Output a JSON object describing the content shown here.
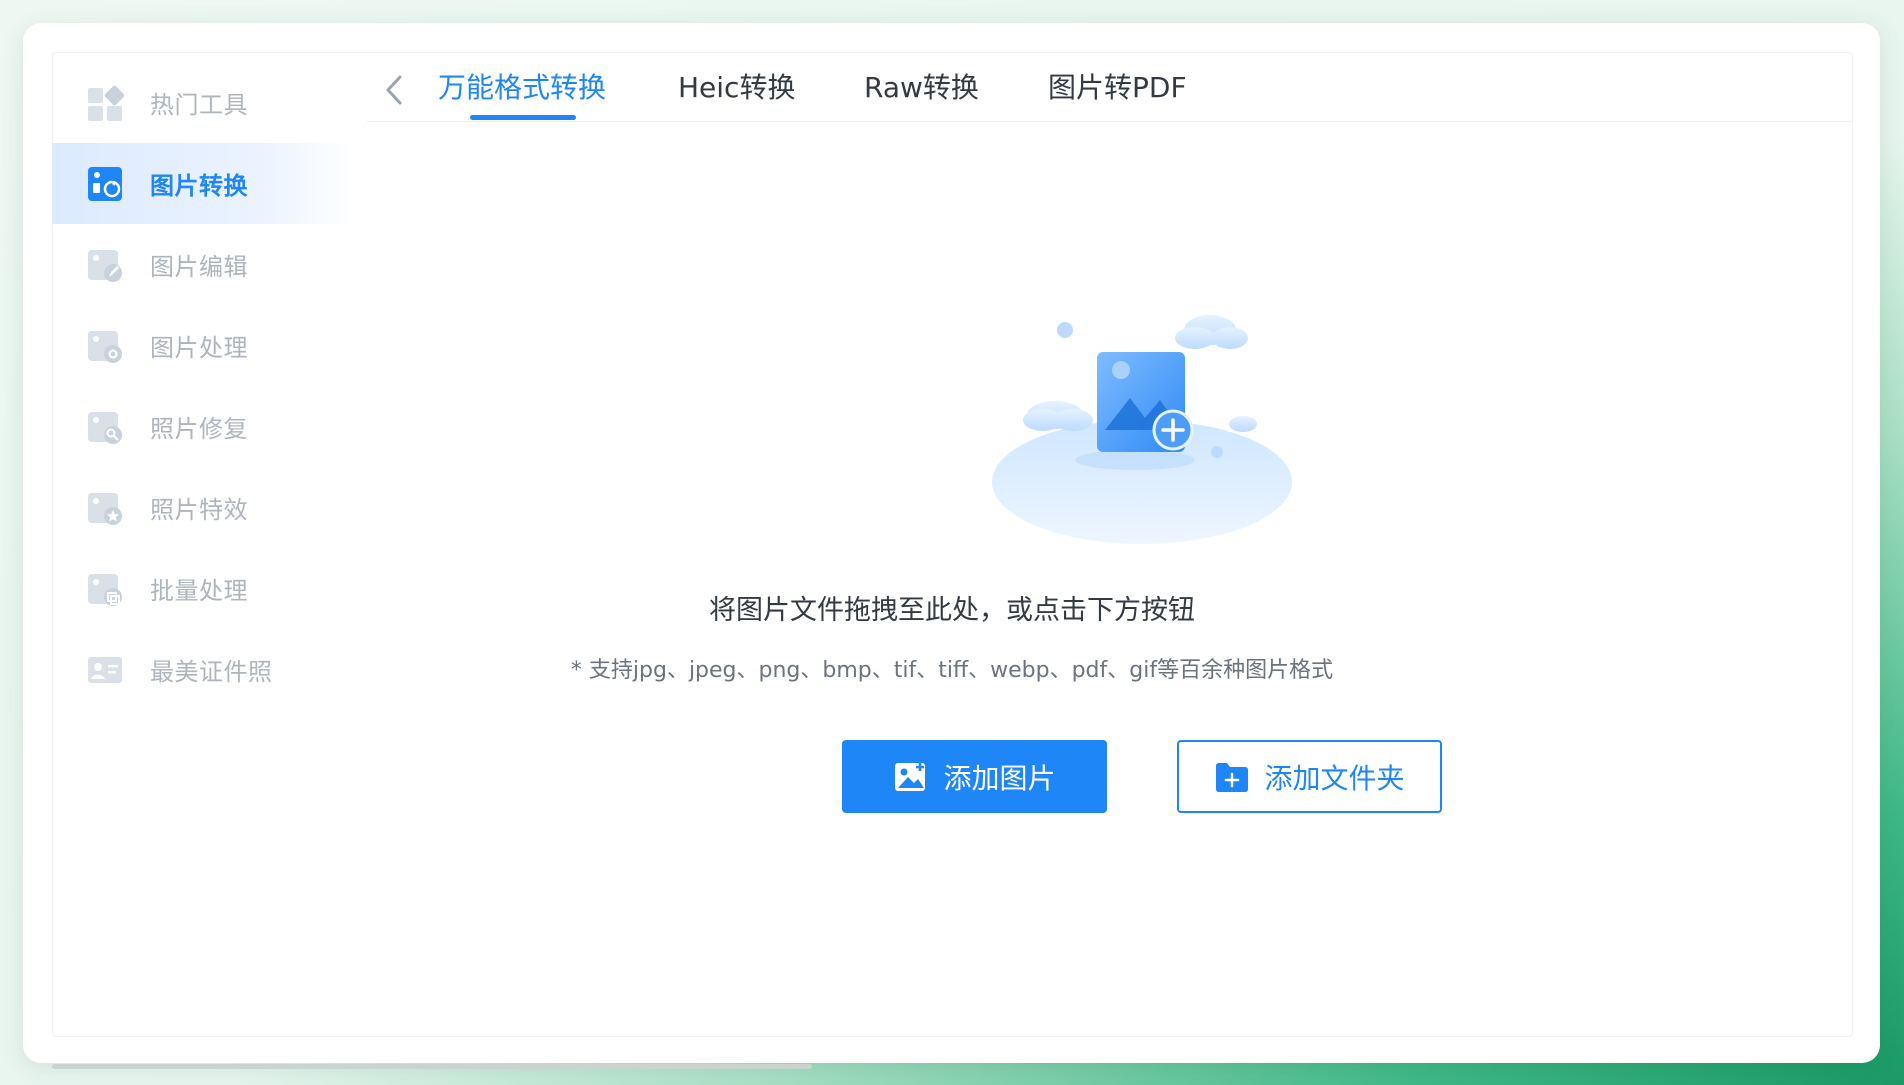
{
  "sidebar": {
    "items": [
      {
        "label": "热门工具",
        "icon": "hot-tools-icon"
      },
      {
        "label": "图片转换",
        "icon": "image-convert-icon",
        "active": true
      },
      {
        "label": "图片编辑",
        "icon": "image-edit-icon"
      },
      {
        "label": "图片处理",
        "icon": "image-process-icon"
      },
      {
        "label": "照片修复",
        "icon": "photo-repair-icon"
      },
      {
        "label": "照片特效",
        "icon": "photo-effects-icon"
      },
      {
        "label": "批量处理",
        "icon": "batch-process-icon"
      },
      {
        "label": "最美证件照",
        "icon": "id-photo-icon"
      }
    ]
  },
  "tabs": [
    {
      "label": "万能格式转换",
      "active": true
    },
    {
      "label": "Heic转换"
    },
    {
      "label": "Raw转换"
    },
    {
      "label": "图片转PDF"
    }
  ],
  "dropzone": {
    "title": "将图片文件拖拽至此处，或点击下方按钮",
    "hint": "* 支持jpg、jpeg、png、bmp、tif、tiff、webp、pdf、gif等百余种图片格式"
  },
  "buttons": {
    "add_image": "添加图片",
    "add_folder": "添加文件夹"
  },
  "colors": {
    "accent": "#1e86f7",
    "inactive_text": "#aeb5be",
    "background_green": "#1a9a64"
  }
}
